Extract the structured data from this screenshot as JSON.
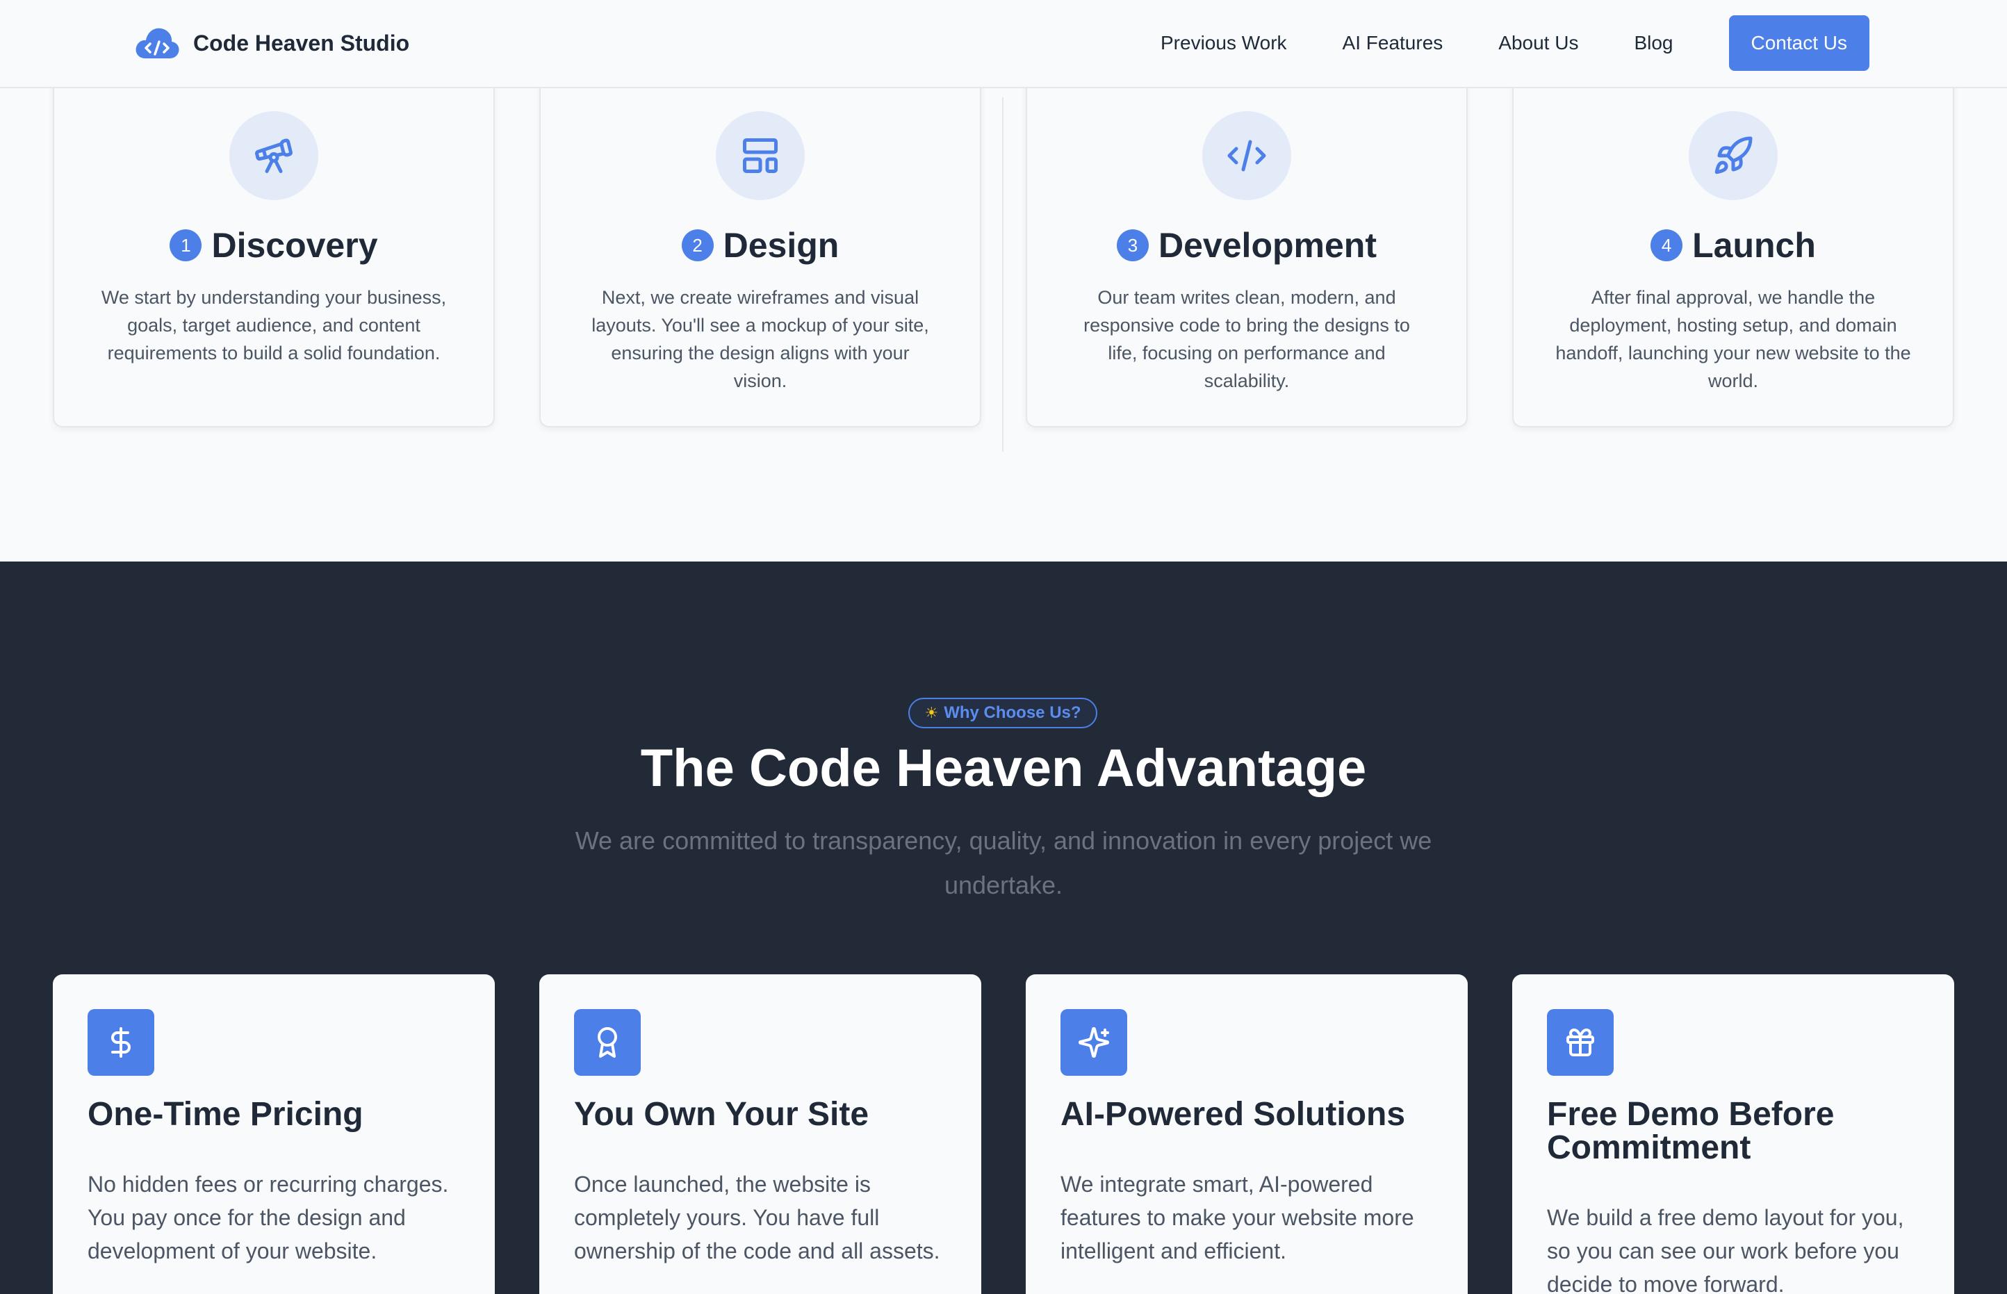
{
  "header": {
    "brand_name": "Code Heaven Studio",
    "brand_icon": "cloud-code-icon",
    "nav": [
      {
        "label": "Previous Work"
      },
      {
        "label": "AI Features"
      },
      {
        "label": "About Us"
      },
      {
        "label": "Blog"
      }
    ],
    "cta_label": "Contact Us"
  },
  "process": {
    "steps": [
      {
        "number": "1",
        "title": "Discovery",
        "icon": "telescope-icon",
        "description": "We start by understanding your business, goals, target audience, and content requirements to build a solid foundation."
      },
      {
        "number": "2",
        "title": "Design",
        "icon": "layout-icon",
        "description": "Next, we create wireframes and visual layouts. You'll see a mockup of your site, ensuring the design aligns with your vision."
      },
      {
        "number": "3",
        "title": "Development",
        "icon": "code-icon",
        "description": "Our team writes clean, modern, and responsive code to bring the designs to life, focusing on performance and scalability."
      },
      {
        "number": "4",
        "title": "Launch",
        "icon": "rocket-icon",
        "description": "After final approval, we handle the deployment, hosting setup, and domain handoff, launching your new website to the world."
      }
    ]
  },
  "advantage": {
    "badge": "Why Choose Us?",
    "badge_icon": "sun-icon",
    "title": "The Code Heaven Advantage",
    "subtitle": "We are committed to transparency, quality, and innovation in every project we undertake.",
    "cards": [
      {
        "title": "One-Time Pricing",
        "icon": "dollar-icon",
        "description": "No hidden fees or recurring charges. You pay once for the design and development of your website."
      },
      {
        "title": "You Own Your Site",
        "icon": "award-icon",
        "description": "Once launched, the website is completely yours. You have full ownership of the code and all assets."
      },
      {
        "title": "AI-Powered Solutions",
        "icon": "sparkles-icon",
        "description": "We integrate smart, AI-powered features to make your website more intelligent and efficient."
      },
      {
        "title": "Free Demo Before Commitment",
        "icon": "gift-icon",
        "description": "We build a free demo layout for you, so you can see our work before you decide to move forward."
      }
    ]
  },
  "colors": {
    "accent": "#4c7fe8",
    "dark_bg": "#222937",
    "page_bg": "#f8fafc"
  }
}
